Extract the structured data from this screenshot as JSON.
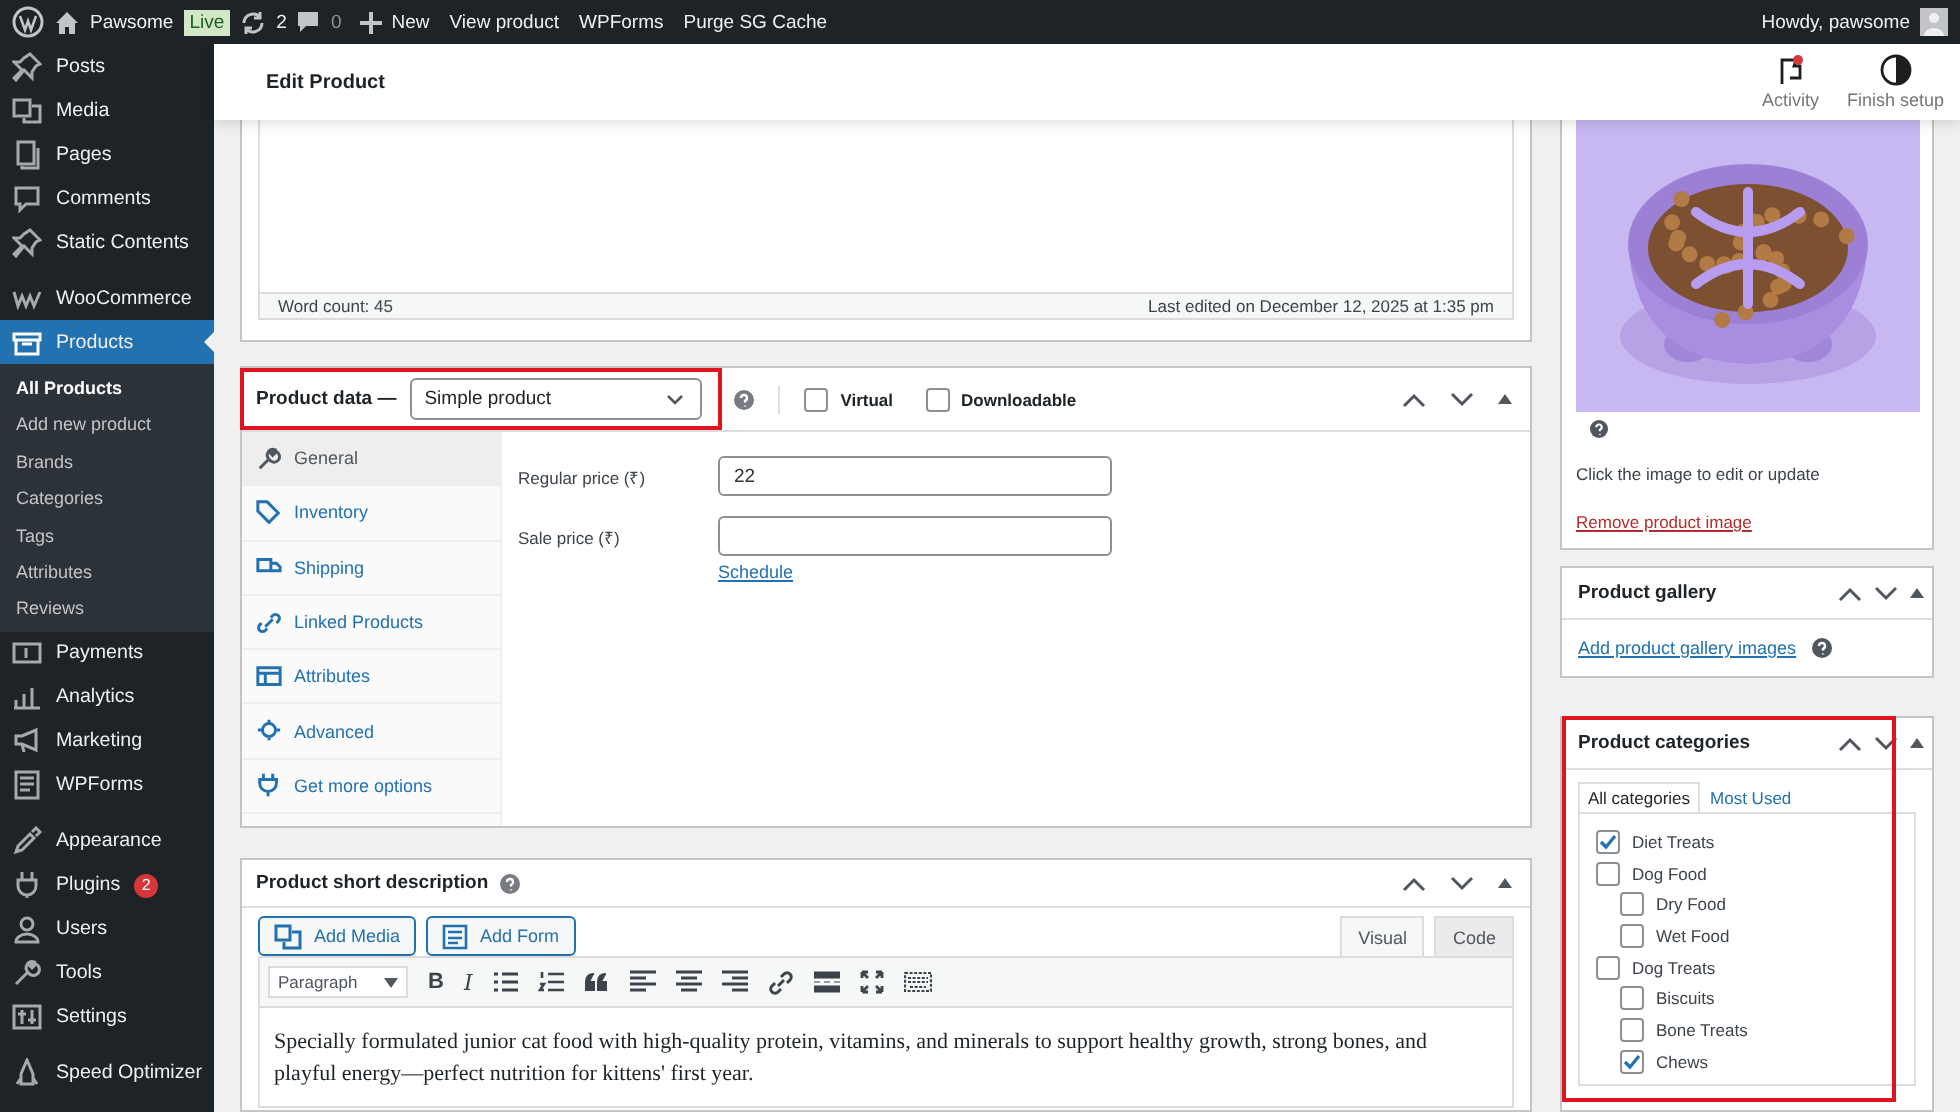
{
  "admin_bar": {
    "site": "Pawsome",
    "badge": "Live",
    "updates": "2",
    "comments": "0",
    "new": "New",
    "links": [
      "View product",
      "WPForms",
      "Purge SG Cache"
    ],
    "greeting": "Howdy, pawsome"
  },
  "sidebar": {
    "groups": [
      [
        {
          "label": "Posts",
          "selected": false
        },
        {
          "label": "Media",
          "selected": false
        },
        {
          "label": "Pages",
          "selected": false
        },
        {
          "label": "Comments",
          "selected": false
        },
        {
          "label": "Static Contents",
          "selected": false
        }
      ],
      [
        {
          "label": "WooCommerce",
          "selected": false
        },
        {
          "label": "Products",
          "selected": true,
          "children": [
            {
              "label": "All Products",
              "selected": true
            },
            {
              "label": "Add new product",
              "selected": false
            },
            {
              "label": "Brands",
              "selected": false
            },
            {
              "label": "Categories",
              "selected": false
            },
            {
              "label": "Tags",
              "selected": false
            },
            {
              "label": "Attributes",
              "selected": false
            },
            {
              "label": "Reviews",
              "selected": false
            }
          ]
        },
        {
          "label": "Payments",
          "selected": false
        },
        {
          "label": "Analytics",
          "selected": false
        },
        {
          "label": "Marketing",
          "selected": false
        },
        {
          "label": "WPForms",
          "selected": false
        }
      ],
      [
        {
          "label": "Appearance",
          "selected": false
        },
        {
          "label": "Plugins",
          "selected": false,
          "badge": "2"
        },
        {
          "label": "Users",
          "selected": false
        },
        {
          "label": "Tools",
          "selected": false
        },
        {
          "label": "Settings",
          "selected": false
        }
      ],
      [
        {
          "label": "Speed Optimizer",
          "selected": false
        }
      ]
    ]
  },
  "header": {
    "title": "Edit Product",
    "actions": [
      {
        "label": "Activity",
        "notification": true
      },
      {
        "label": "Finish setup",
        "notification": false
      }
    ]
  },
  "editor": {
    "word_count": "Word count: 45",
    "last_edited": "Last edited on December 12, 2025 at 1:35 pm"
  },
  "product_data": {
    "title": "Product data —",
    "type": "Simple product",
    "highlight": true,
    "options": [
      {
        "label": "Virtual",
        "checked": false
      },
      {
        "label": "Downloadable",
        "checked": false
      }
    ],
    "tabs": [
      {
        "label": "General",
        "selected": true
      },
      {
        "label": "Inventory",
        "selected": false
      },
      {
        "label": "Shipping",
        "selected": false
      },
      {
        "label": "Linked Products",
        "selected": false
      },
      {
        "label": "Attributes",
        "selected": false
      },
      {
        "label": "Advanced",
        "selected": false
      },
      {
        "label": "Get more options",
        "selected": false
      }
    ],
    "fields": [
      {
        "label": "Regular price (₹)",
        "value": "22"
      },
      {
        "label": "Sale price (₹)"
      }
    ],
    "schedule_link": "Schedule"
  },
  "short_description": {
    "title": "Product short description",
    "buttons": [
      "Add Media",
      "Add Form"
    ],
    "modes": [
      {
        "label": "Visual",
        "selected": true
      },
      {
        "label": "Code",
        "selected": false
      }
    ],
    "format": "Paragraph",
    "format_buttons": [
      "B",
      "I"
    ],
    "text": "Specially formulated junior cat food with high-quality protein, vitamins, and minerals to support healthy growth, strong bones, and playful energy—perfect nutrition for kittens' first year."
  },
  "product_image": {
    "hint": "Click the image to edit or update",
    "remove_link": "Remove product image"
  },
  "product_gallery": {
    "title": "Product gallery",
    "link": "Add product gallery images"
  },
  "product_categories": {
    "title": "Product categories",
    "highlight": true,
    "tabs": [
      {
        "label": "All categories",
        "selected": true
      },
      {
        "label": "Most Used",
        "selected": false
      }
    ],
    "items": [
      {
        "label": "Diet Treats",
        "checked": true
      },
      {
        "label": "Dog Food",
        "checked": false,
        "children": [
          {
            "label": "Dry Food",
            "checked": false
          },
          {
            "label": "Wet Food",
            "checked": false
          }
        ]
      },
      {
        "label": "Dog Treats",
        "checked": false,
        "children": [
          {
            "label": "Biscuits",
            "checked": false
          },
          {
            "label": "Bone Treats",
            "checked": false
          },
          {
            "label": "Chews",
            "checked": true
          }
        ]
      }
    ]
  }
}
